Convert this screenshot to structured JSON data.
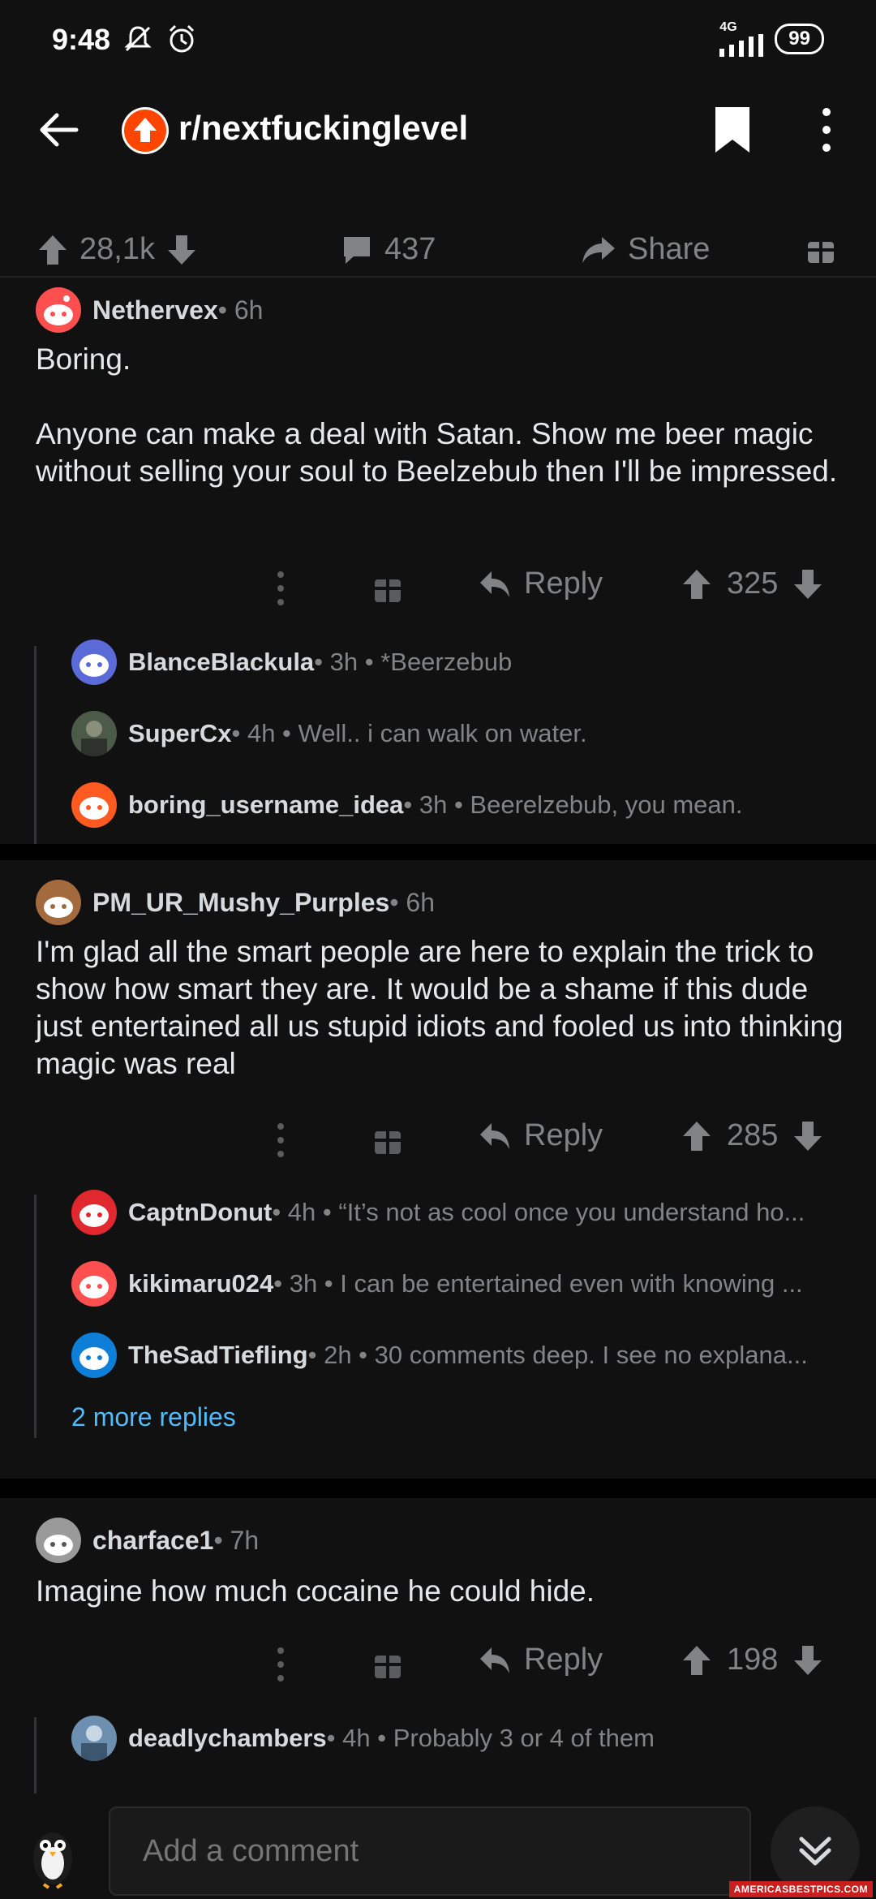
{
  "status": {
    "time": "9:48",
    "network": "4G",
    "battery": "99"
  },
  "header": {
    "subreddit": "r/nextfuckinglevel"
  },
  "post_actions": {
    "upvotes": "28,1k",
    "comments": "437",
    "share_label": "Share"
  },
  "comments": [
    {
      "author": "Nethervex",
      "meta": " • 6h",
      "body": "Boring.\n\nAnyone can make a deal with Satan. Show me beer magic without selling your soul to Beelzebub then I'll be impressed.",
      "reply_label": "Reply",
      "score": "325",
      "avatar_color": "#ff4f4f",
      "replies": [
        {
          "author": "BlanceBlackula",
          "meta": " • 3h • *Beerzebub",
          "avatar_color": "#5a6ad6"
        },
        {
          "author": "SuperCx",
          "meta": " • 4h • Well.. i can walk on water.",
          "avatar_color": "#4c5a4a"
        },
        {
          "author": "boring_username_idea",
          "meta": " • 3h • Beerelzebub, you mean.",
          "avatar_color": "#ff5a1f"
        }
      ]
    },
    {
      "author": "PM_UR_Mushy_Purples",
      "meta": " • 6h",
      "body": "I'm glad all the smart people are here to explain the trick to show how smart they are. It would be a shame if this dude just entertained all us stupid idiots and fooled us into thinking magic was real",
      "reply_label": "Reply",
      "score": "285",
      "avatar_color": "#a36a3d",
      "replies": [
        {
          "author": "CaptnDonut",
          "meta": " • 4h • “It’s not as cool once you understand ho...",
          "avatar_color": "#e0282e"
        },
        {
          "author": "kikimaru024",
          "meta": " • 3h • I can be entertained even with knowing ...",
          "avatar_color": "#ff4f4f"
        },
        {
          "author": "TheSadTiefling",
          "meta": " • 2h • 30 comments deep. I see no explana...",
          "avatar_color": "#0d7fd9"
        }
      ],
      "more_replies": "2 more replies"
    },
    {
      "author": "charface1",
      "meta": " • 7h",
      "body": "Imagine how much cocaine he could hide.",
      "reply_label": "Reply",
      "score": "198",
      "avatar_color": "#9a9a9a",
      "replies": [
        {
          "author": "deadlychambers",
          "meta": " • 4h • Probably 3 or 4 of them",
          "avatar_color": "#6d8fb0"
        }
      ]
    }
  ],
  "composer": {
    "placeholder": "Add a comment"
  },
  "watermark": "AMERICASBESTPICS.COM",
  "colors": {
    "background": "#111112",
    "muted": "#818384",
    "link": "#4fbcff",
    "reddit_orange": "#ff4500"
  }
}
